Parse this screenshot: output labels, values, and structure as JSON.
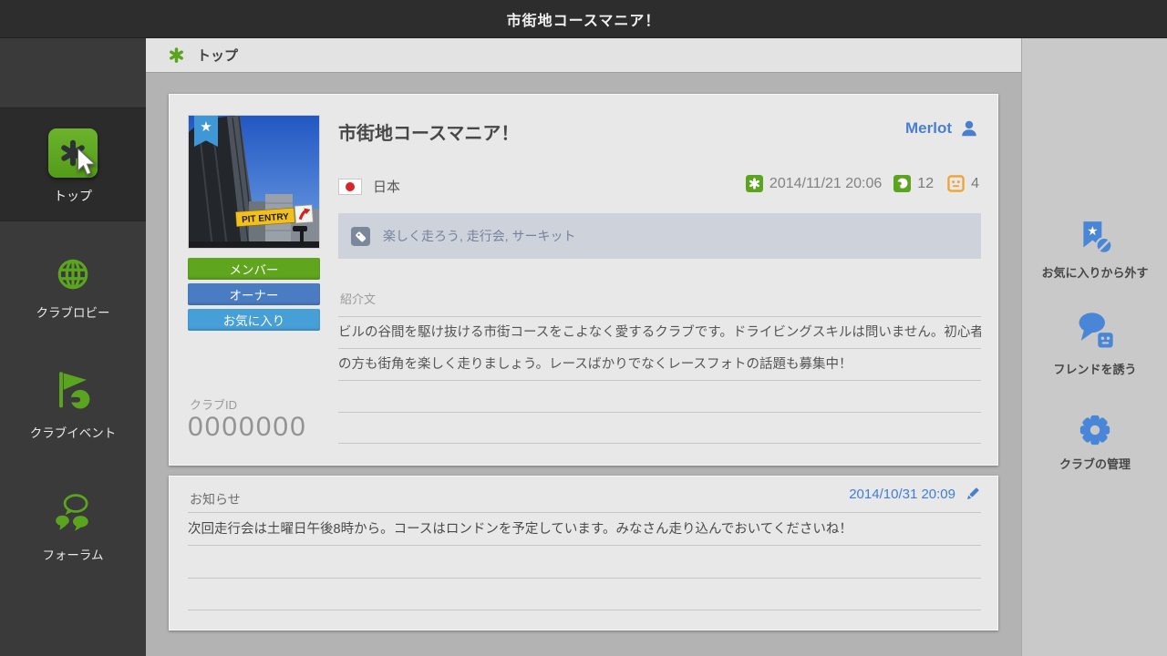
{
  "window": {
    "title": "市街地コースマニア！"
  },
  "sidebar": {
    "items": [
      {
        "label": "トップ"
      },
      {
        "label": "クラブロビー"
      },
      {
        "label": "クラブイベント"
      },
      {
        "label": "フォーラム"
      }
    ]
  },
  "header": {
    "title": "トップ"
  },
  "club": {
    "name": "市街地コースマニア！",
    "owner": "Merlot",
    "country": "日本",
    "created": "2014/11/21 20:06",
    "members": "12",
    "topics": "4",
    "tags": "楽しく走ろう, 走行会, サーキット",
    "image": {
      "sign_text": "PIT ENTRY"
    },
    "fav_star": "★",
    "buttons": [
      {
        "label": "メンバー"
      },
      {
        "label": "オーナー"
      },
      {
        "label": "お気に入り"
      }
    ],
    "intro_label": "紹介文",
    "intro_lines": [
      "ビルの谷間を駆け抜ける市街コースをこよなく愛するクラブです。ドライビングスキルは問いません。初心者",
      "の方も街角を楽しく走りましょう。レースばかりでなくレースフォトの話題も募集中！"
    ],
    "club_id_label": "クラブID",
    "club_id": "0000000"
  },
  "announcement": {
    "label": "お知らせ",
    "date": "2014/10/31 20:09",
    "text": "次回走行会は土曜日午後8時から。コースはロンドンを予定しています。みなさん走り込んでおいてくださいね！"
  },
  "actions": [
    {
      "label": "お気に入りから外す"
    },
    {
      "label": "フレンドを誘う"
    },
    {
      "label": "クラブの管理"
    }
  ],
  "colors": {
    "accent_green": "#5ba41f",
    "accent_blue": "#4a7fd0",
    "button_green": "#5fa51e",
    "button_blue": "#4a7cc3",
    "button_lightblue": "#479fd8",
    "badge_orange": "#f0a233",
    "tag_slate": "#7b879b"
  }
}
